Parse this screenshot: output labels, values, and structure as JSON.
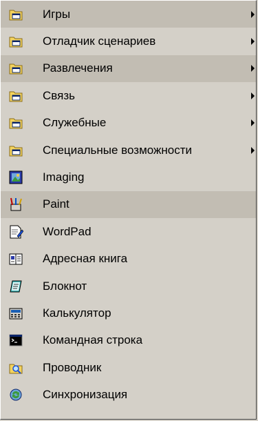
{
  "menu": {
    "items": [
      {
        "label": "Игры",
        "icon": "program-group-folder-icon",
        "submenu": true,
        "highlighted": true
      },
      {
        "label": "Отладчик сценариев",
        "icon": "program-group-folder-icon",
        "submenu": true,
        "highlighted": false
      },
      {
        "label": "Развлечения",
        "icon": "program-group-folder-icon",
        "submenu": true,
        "highlighted": true
      },
      {
        "label": "Связь",
        "icon": "program-group-folder-icon",
        "submenu": true,
        "highlighted": false
      },
      {
        "label": "Служебные",
        "icon": "program-group-folder-icon",
        "submenu": true,
        "highlighted": false
      },
      {
        "label": "Специальные возможности",
        "icon": "program-group-folder-icon",
        "submenu": true,
        "highlighted": false
      },
      {
        "label": "Imaging",
        "icon": "imaging-icon",
        "submenu": false,
        "highlighted": false
      },
      {
        "label": "Paint",
        "icon": "paint-icon",
        "submenu": false,
        "highlighted": true
      },
      {
        "label": "WordPad",
        "icon": "wordpad-icon",
        "submenu": false,
        "highlighted": false
      },
      {
        "label": "Адресная книга",
        "icon": "address-book-icon",
        "submenu": false,
        "highlighted": false
      },
      {
        "label": "Блокнот",
        "icon": "notepad-icon",
        "submenu": false,
        "highlighted": false
      },
      {
        "label": "Калькулятор",
        "icon": "calculator-icon",
        "submenu": false,
        "highlighted": false
      },
      {
        "label": "Командная строка",
        "icon": "command-prompt-icon",
        "submenu": false,
        "highlighted": false
      },
      {
        "label": "Проводник",
        "icon": "explorer-icon",
        "submenu": false,
        "highlighted": false
      },
      {
        "label": "Синхронизация",
        "icon": "synchronize-icon",
        "submenu": false,
        "highlighted": false
      }
    ]
  },
  "colors": {
    "menu_background": "#d4d0c8",
    "highlight_background": "#c2bdb3",
    "text": "#000000",
    "folder": "#f4d35e",
    "window_blue": "#0a246a"
  }
}
